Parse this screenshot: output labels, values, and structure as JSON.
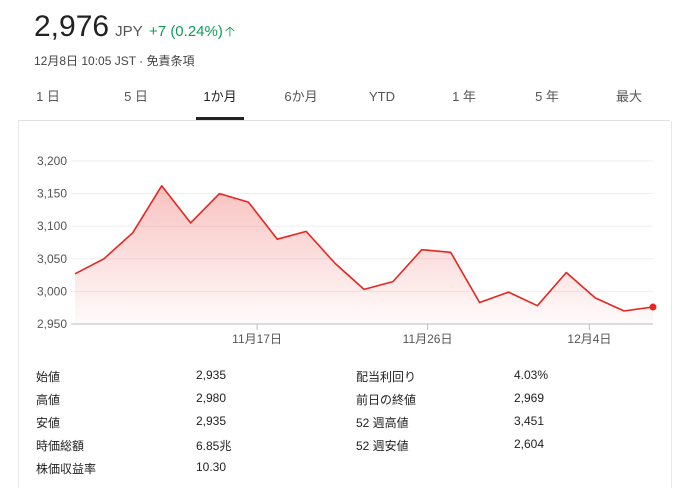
{
  "quote": {
    "price": "2,976",
    "currency": "JPY",
    "change": "+7 (0.24%)",
    "arrow_icon": "arrow-up-icon",
    "meta": "12月8日 10:05 JST · 免責条項"
  },
  "tabs": [
    {
      "label": "1 日",
      "active": false
    },
    {
      "label": "5 日",
      "active": false
    },
    {
      "label": "1か月",
      "active": true
    },
    {
      "label": "6か月",
      "active": false
    },
    {
      "label": "YTD",
      "active": false
    },
    {
      "label": "1 年",
      "active": false
    },
    {
      "label": "5 年",
      "active": false
    },
    {
      "label": "最大",
      "active": false
    }
  ],
  "colors": {
    "line": "#e6261f",
    "positive": "#0f9d58",
    "grid": "#eeeeee"
  },
  "chart_data": {
    "type": "area",
    "title": "",
    "xlabel": "",
    "ylabel": "",
    "x_tick_labels": [
      "11月17日",
      "11月26日",
      "12月4日"
    ],
    "x_tick_index": [
      6.3,
      12.2,
      17.8
    ],
    "y_ticks": [
      2950,
      3000,
      3050,
      3100,
      3150,
      3200
    ],
    "y_tick_labels": [
      "2,950",
      "3,000",
      "3,050",
      "3,100",
      "3,150",
      "3,200"
    ],
    "ylim": [
      2950,
      3200
    ],
    "grid": true,
    "series": [
      {
        "values": [
          3027,
          3050,
          3090,
          3162,
          3105,
          3150,
          3137,
          3080,
          3092,
          3043,
          3003,
          3015,
          3064,
          3060,
          2983,
          2999,
          2978,
          3029,
          2990,
          2970,
          2976
        ]
      }
    ]
  },
  "stats": {
    "left": [
      {
        "label": "始値",
        "value": "2,935"
      },
      {
        "label": "高値",
        "value": "2,980"
      },
      {
        "label": "安値",
        "value": "2,935"
      },
      {
        "label": "時価総額",
        "value": "6.85兆"
      },
      {
        "label": "株価収益率",
        "value": "10.30"
      }
    ],
    "right": [
      {
        "label": "配当利回り",
        "value": "4.03%"
      },
      {
        "label": "前日の終値",
        "value": "2,969"
      },
      {
        "label": "52 週高値",
        "value": "3,451"
      },
      {
        "label": "52 週安値",
        "value": "2,604"
      }
    ]
  }
}
